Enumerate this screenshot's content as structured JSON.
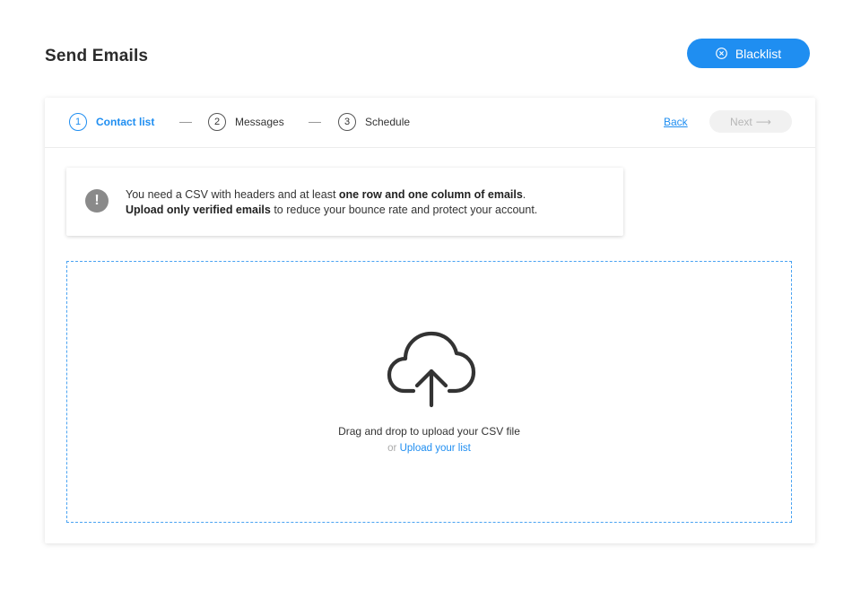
{
  "page": {
    "title": "Send Emails"
  },
  "header": {
    "blacklist_label": "Blacklist"
  },
  "stepper": {
    "steps": [
      {
        "number": "1",
        "label": "Contact list",
        "active": true
      },
      {
        "number": "2",
        "label": "Messages",
        "active": false
      },
      {
        "number": "3",
        "label": "Schedule",
        "active": false
      }
    ],
    "back_label": "Back",
    "next_label": "Next",
    "next_arrow": "⟶"
  },
  "notice": {
    "line1_prefix": "You need a CSV with headers and at least ",
    "line1_bold": "one row and one column of emails",
    "line1_suffix": ".",
    "line2_bold": "Upload only verified emails",
    "line2_suffix": " to reduce your bounce rate and protect your account.",
    "icon": "exclamation-icon"
  },
  "dropzone": {
    "main_text": "Drag and drop to upload your CSV file",
    "or_text": "or",
    "upload_link": "Upload your list",
    "icon": "cloud-upload-icon"
  },
  "colors": {
    "accent": "#1f8ef1",
    "disabled_bg": "#f1f1f1",
    "disabled_text": "#b7b7b7"
  }
}
